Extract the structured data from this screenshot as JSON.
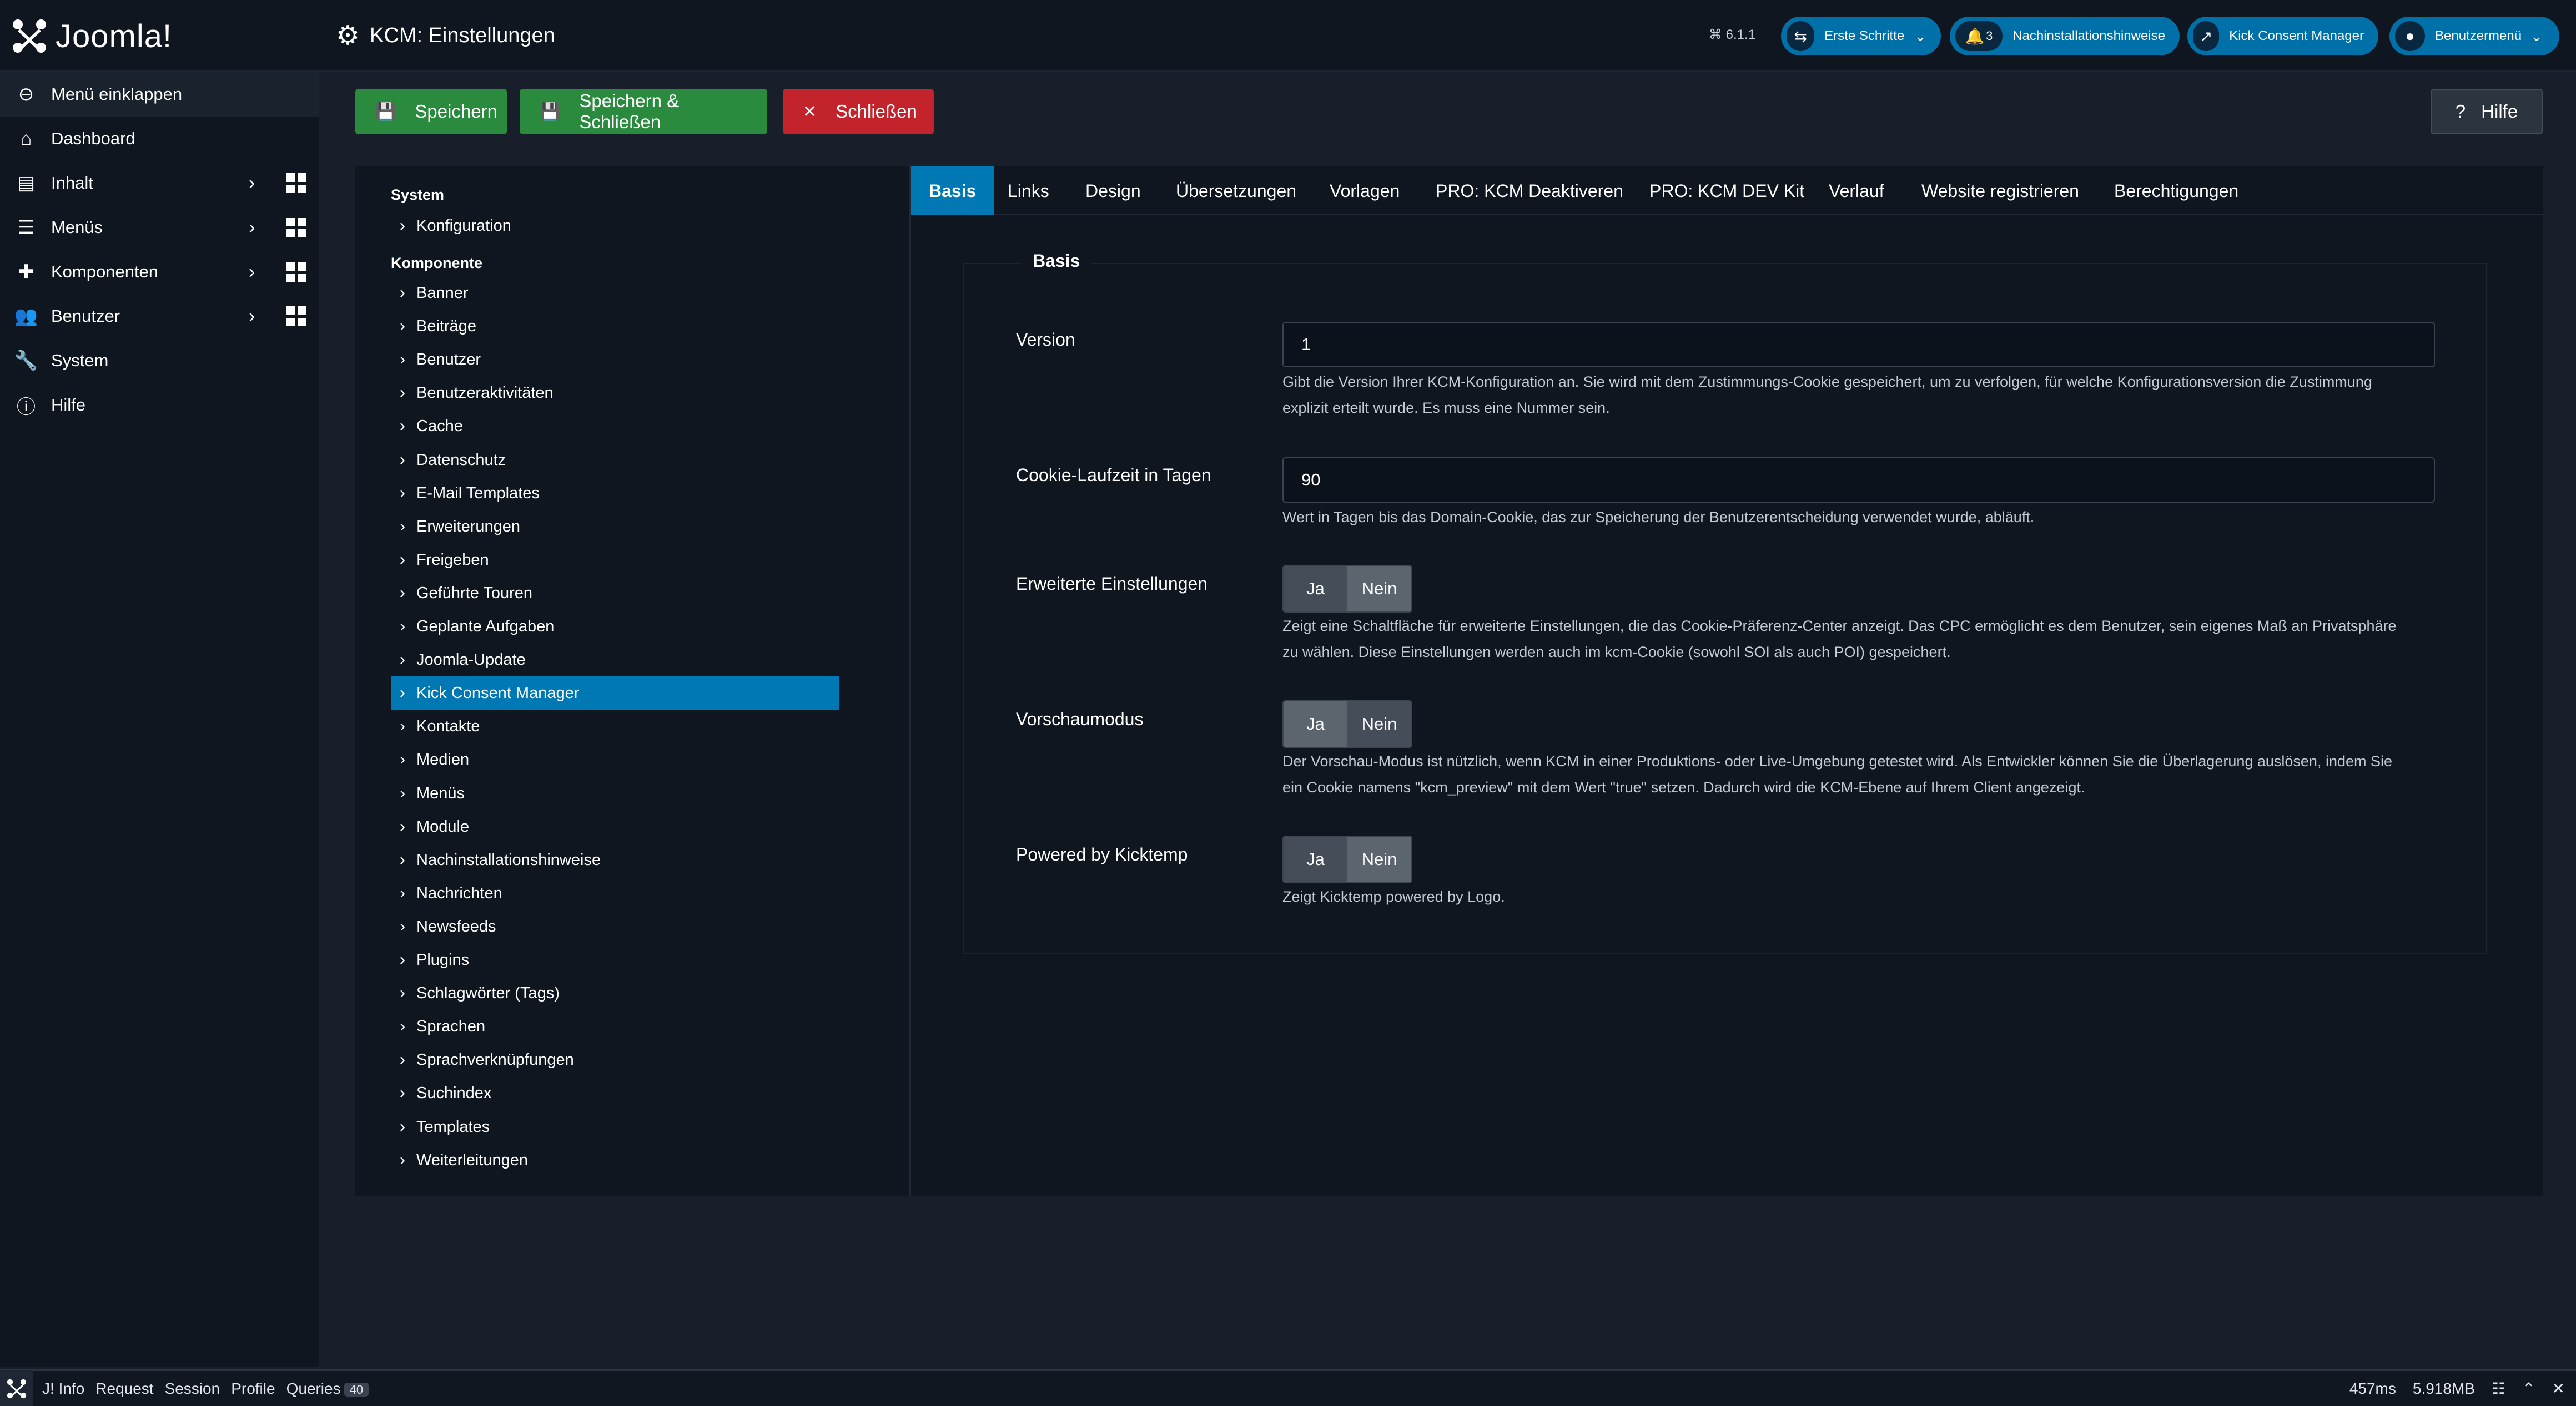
{
  "header": {
    "brand": "Joomla!",
    "title": "KCM: Einstellungen",
    "version": "⌘ 6.1.1",
    "pills": [
      {
        "label": "Erste Schritte",
        "badge": ""
      },
      {
        "label": "Nachinstallationshinweise",
        "badge": "3"
      },
      {
        "label": "Kick Consent Manager",
        "badge": ""
      },
      {
        "label": "Benutzermenü",
        "badge": ""
      }
    ]
  },
  "sidebar": {
    "items": [
      {
        "label": "Menü einklappen",
        "icon": "toggle-icon"
      },
      {
        "label": "Dashboard",
        "icon": "home-icon"
      },
      {
        "label": "Inhalt",
        "icon": "file-icon"
      },
      {
        "label": "Menüs",
        "icon": "list-icon"
      },
      {
        "label": "Komponenten",
        "icon": "puzzle-icon"
      },
      {
        "label": "Benutzer",
        "icon": "users-icon"
      },
      {
        "label": "System",
        "icon": "wrench-icon"
      },
      {
        "label": "Hilfe",
        "icon": "info-icon"
      }
    ]
  },
  "toolbar": {
    "save": "Speichern",
    "save_close": "Speichern & Schließen",
    "close": "Schließen",
    "help": "Hilfe"
  },
  "tree": {
    "system_heading": "System",
    "system_items": [
      "Konfiguration"
    ],
    "components_heading": "Komponente",
    "components": [
      "Banner",
      "Beiträge",
      "Benutzer",
      "Benutzeraktivitäten",
      "Cache",
      "Datenschutz",
      "E-Mail Templates",
      "Erweiterungen",
      "Freigeben",
      "Geführte Touren",
      "Geplante Aufgaben",
      "Joomla-Update",
      "Kick Consent Manager",
      "Kontakte",
      "Medien",
      "Menüs",
      "Module",
      "Nachinstallationshinweise",
      "Nachrichten",
      "Newsfeeds",
      "Plugins",
      "Schlagwörter (Tags)",
      "Sprachen",
      "Sprachverknüpfungen",
      "Suchindex",
      "Templates",
      "Weiterleitungen"
    ],
    "active": "Kick Consent Manager"
  },
  "tabs": [
    "Basis",
    "Links",
    "Design",
    "Übersetzungen",
    "Vorlagen",
    "PRO: KCM Deaktiveren",
    "PRO: KCM DEV Kit",
    "Verlauf",
    "Website registrieren",
    "Berechtigungen"
  ],
  "active_tab": "Basis",
  "form": {
    "legend": "Basis",
    "version": {
      "label": "Version",
      "value": "1",
      "desc1": "Gibt die Version Ihrer KCM-Konfiguration an. Sie wird mit dem Zustimmungs-Cookie gespeichert, um zu verfolgen, für welche Konfigurationsversion die Zustimmung",
      "desc2": "explizit erteilt wurde. Es muss eine Nummer sein."
    },
    "cookie": {
      "label": "Cookie-Laufzeit in Tagen",
      "value": "90",
      "desc1": "Wert in Tagen bis das Domain-Cookie, das zur Speicherung der Benutzerentscheidung verwendet wurde, abläuft."
    },
    "advanced": {
      "label": "Erweiterte Einstellungen",
      "yes": "Ja",
      "no": "Nein",
      "selected": "Nein",
      "desc1": "Zeigt eine Schaltfläche für erweiterte Einstellungen, die das Cookie-Präferenz-Center anzeigt. Das CPC ermöglicht es dem Benutzer, sein eigenes Maß an Privatsphäre",
      "desc2": "zu wählen. Diese Einstellungen werden auch im kcm-Cookie (sowohl SOI als auch POI) gespeichert."
    },
    "preview": {
      "label": "Vorschaumodus",
      "yes": "Ja",
      "no": "Nein",
      "selected": "Ja",
      "desc1": "Der Vorschau-Modus ist nützlich, wenn KCM in einer Produktions- oder Live-Umgebung getestet wird. Als Entwickler können Sie die Überlagerung auslösen, indem Sie",
      "desc2": "ein Cookie namens \"kcm_preview\" mit dem Wert \"true\" setzen. Dadurch wird die KCM-Ebene auf Ihrem Client angezeigt."
    },
    "powered": {
      "label": "Powered by Kicktemp",
      "yes": "Ja",
      "no": "Nein",
      "selected": "Nein",
      "desc1": "Zeigt Kicktemp powered by Logo."
    }
  },
  "debugbar": {
    "items": [
      "J! Info",
      "Request",
      "Session",
      "Profile",
      "Queries"
    ],
    "queries_count": "40",
    "time": "457ms",
    "memory": "5.918MB"
  },
  "colors": {
    "primary": "#0078b4",
    "success": "#2a8a3e",
    "danger": "#c3232b",
    "background": "#181f2b",
    "sidebar": "#0f1620"
  }
}
